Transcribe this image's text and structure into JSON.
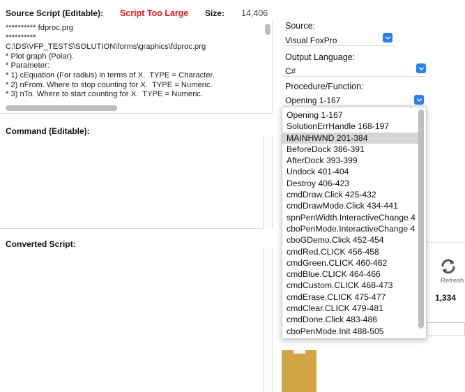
{
  "header": {
    "source_script_label": "Source Script (Editable):",
    "status_warning": "Script Too Large",
    "size_label": "Size:",
    "size_value": "14,406"
  },
  "source_script": {
    "lines": [
      "********** fdproc.prg",
      "**********",
      "C:\\DS\\VFP_TESTS\\SOLUTION\\forms\\graphics\\fdproc.prg",
      "* Plot graph (Polar).",
      "* Parameter:",
      "* 1) cEquation (For radius) in terms of X.  TYPE = Character.",
      "* 2) nFrom. Where to stop counting for X.  TYPE = Numeric.",
      "* 3) nTo. Where to start counting for X.  TYPE = Numeric."
    ]
  },
  "command": {
    "label": "Command (Editable):"
  },
  "converted": {
    "label": "Converted Script:"
  },
  "source": {
    "label": "Source:",
    "value": "Visual FoxPro"
  },
  "output_language": {
    "label": "Output Language:",
    "value": "C#"
  },
  "procedure": {
    "label": "Procedure/Function:",
    "value": "Opening 1-167",
    "selected_index": 2,
    "options": [
      "Opening 1-167",
      "SolutionErrHandle 168-197",
      "MAINHWND 201-384",
      "BeforeDock 386-391",
      "AfterDock 393-399",
      "Undock 401-404",
      "Destroy 406-423",
      "cmdDraw.Click 425-432",
      "cmdDrawMode.Click 434-441",
      "spnPenWidth.InteractiveChange 4",
      "cboPenMode.InteractiveChange 4",
      "cboGDemo.Click 452-454",
      "cmdRed.CLICK 456-458",
      "cmdGreen.CLICK 460-462",
      "cmdBlue.CLICK 464-466",
      "cmdCustom.CLICK 468-473",
      "cmdErase.CLICK 475-477",
      "cmdClear.CLICK 479-481",
      "cmdDone.Click 483-486",
      "cboPenMode.Init 488-505"
    ]
  },
  "refresh": {
    "label": "Refresh",
    "icon": "refresh-icon"
  },
  "count_value": "1,334",
  "colors": {
    "accent": "#2a7ef0",
    "warning": "#e0141e",
    "swatch": "#d3a645"
  }
}
